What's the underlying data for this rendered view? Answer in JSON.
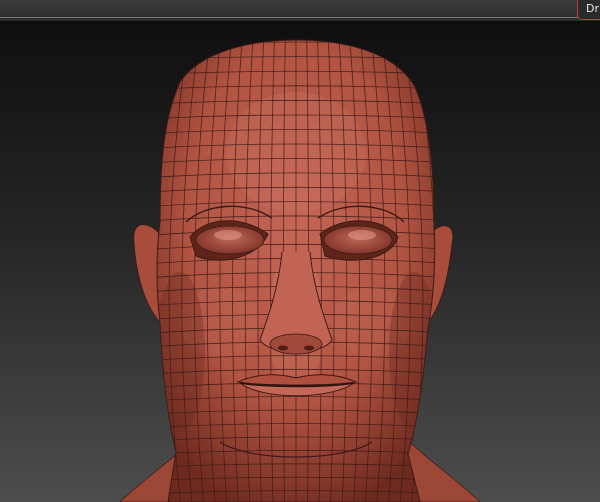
{
  "toolbar": {
    "draw_label": "Dr"
  },
  "viewport": {
    "model_color": "#b25442",
    "wire_color": "#3a1b16",
    "highlight_color": "#d98374",
    "shadow_color": "#6e2a1f"
  }
}
